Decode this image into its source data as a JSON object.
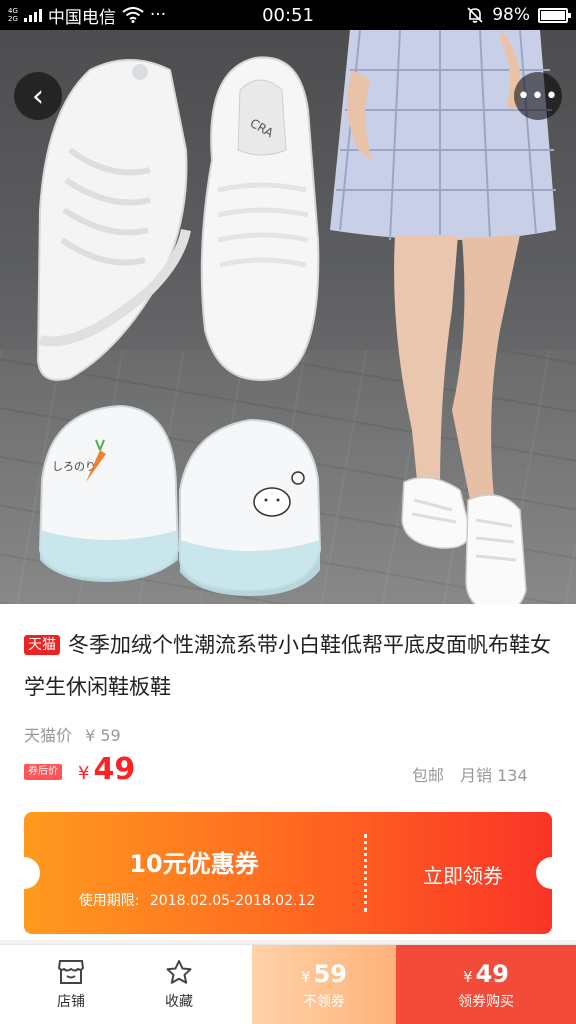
{
  "status_bar": {
    "network_top": "4G",
    "network_bottom": "2G",
    "carrier": "中国电信",
    "more": "···",
    "time": "00:51",
    "battery": "98%",
    "battery_level": 0.98
  },
  "hero": {
    "slide_count": 6,
    "active_slide": 0,
    "back_icon": "‹",
    "more_icon": "•••",
    "shoe_lettering": "しろのり"
  },
  "product": {
    "platform_badge": "天猫",
    "title": "冬季加绒个性潮流系带小白鞋低帮平底皮面帆布鞋女学生休闲鞋板鞋",
    "orig_price_label": "天猫价",
    "orig_price": "¥ 59",
    "after_coupon_badge": "券后价",
    "currency": "¥",
    "price": "49",
    "shipping": "包邮",
    "sales": "月销 134"
  },
  "coupon": {
    "amount": "10元优惠券",
    "validity_label": "使用期限:",
    "validity_range": "2018.02.05-2018.02.12",
    "claim_label": "立即领券"
  },
  "bottom_bar": {
    "store_label": "店铺",
    "favorite_label": "收藏",
    "normal_currency": "¥",
    "normal_price": "59",
    "normal_label": "不领券",
    "coupon_currency": "¥",
    "coupon_price": "49",
    "coupon_label": "领券购买"
  },
  "colors": {
    "accent_red": "#f22222",
    "coupon_orange": "#ff9a1f",
    "coupon_red": "#fa3427"
  }
}
